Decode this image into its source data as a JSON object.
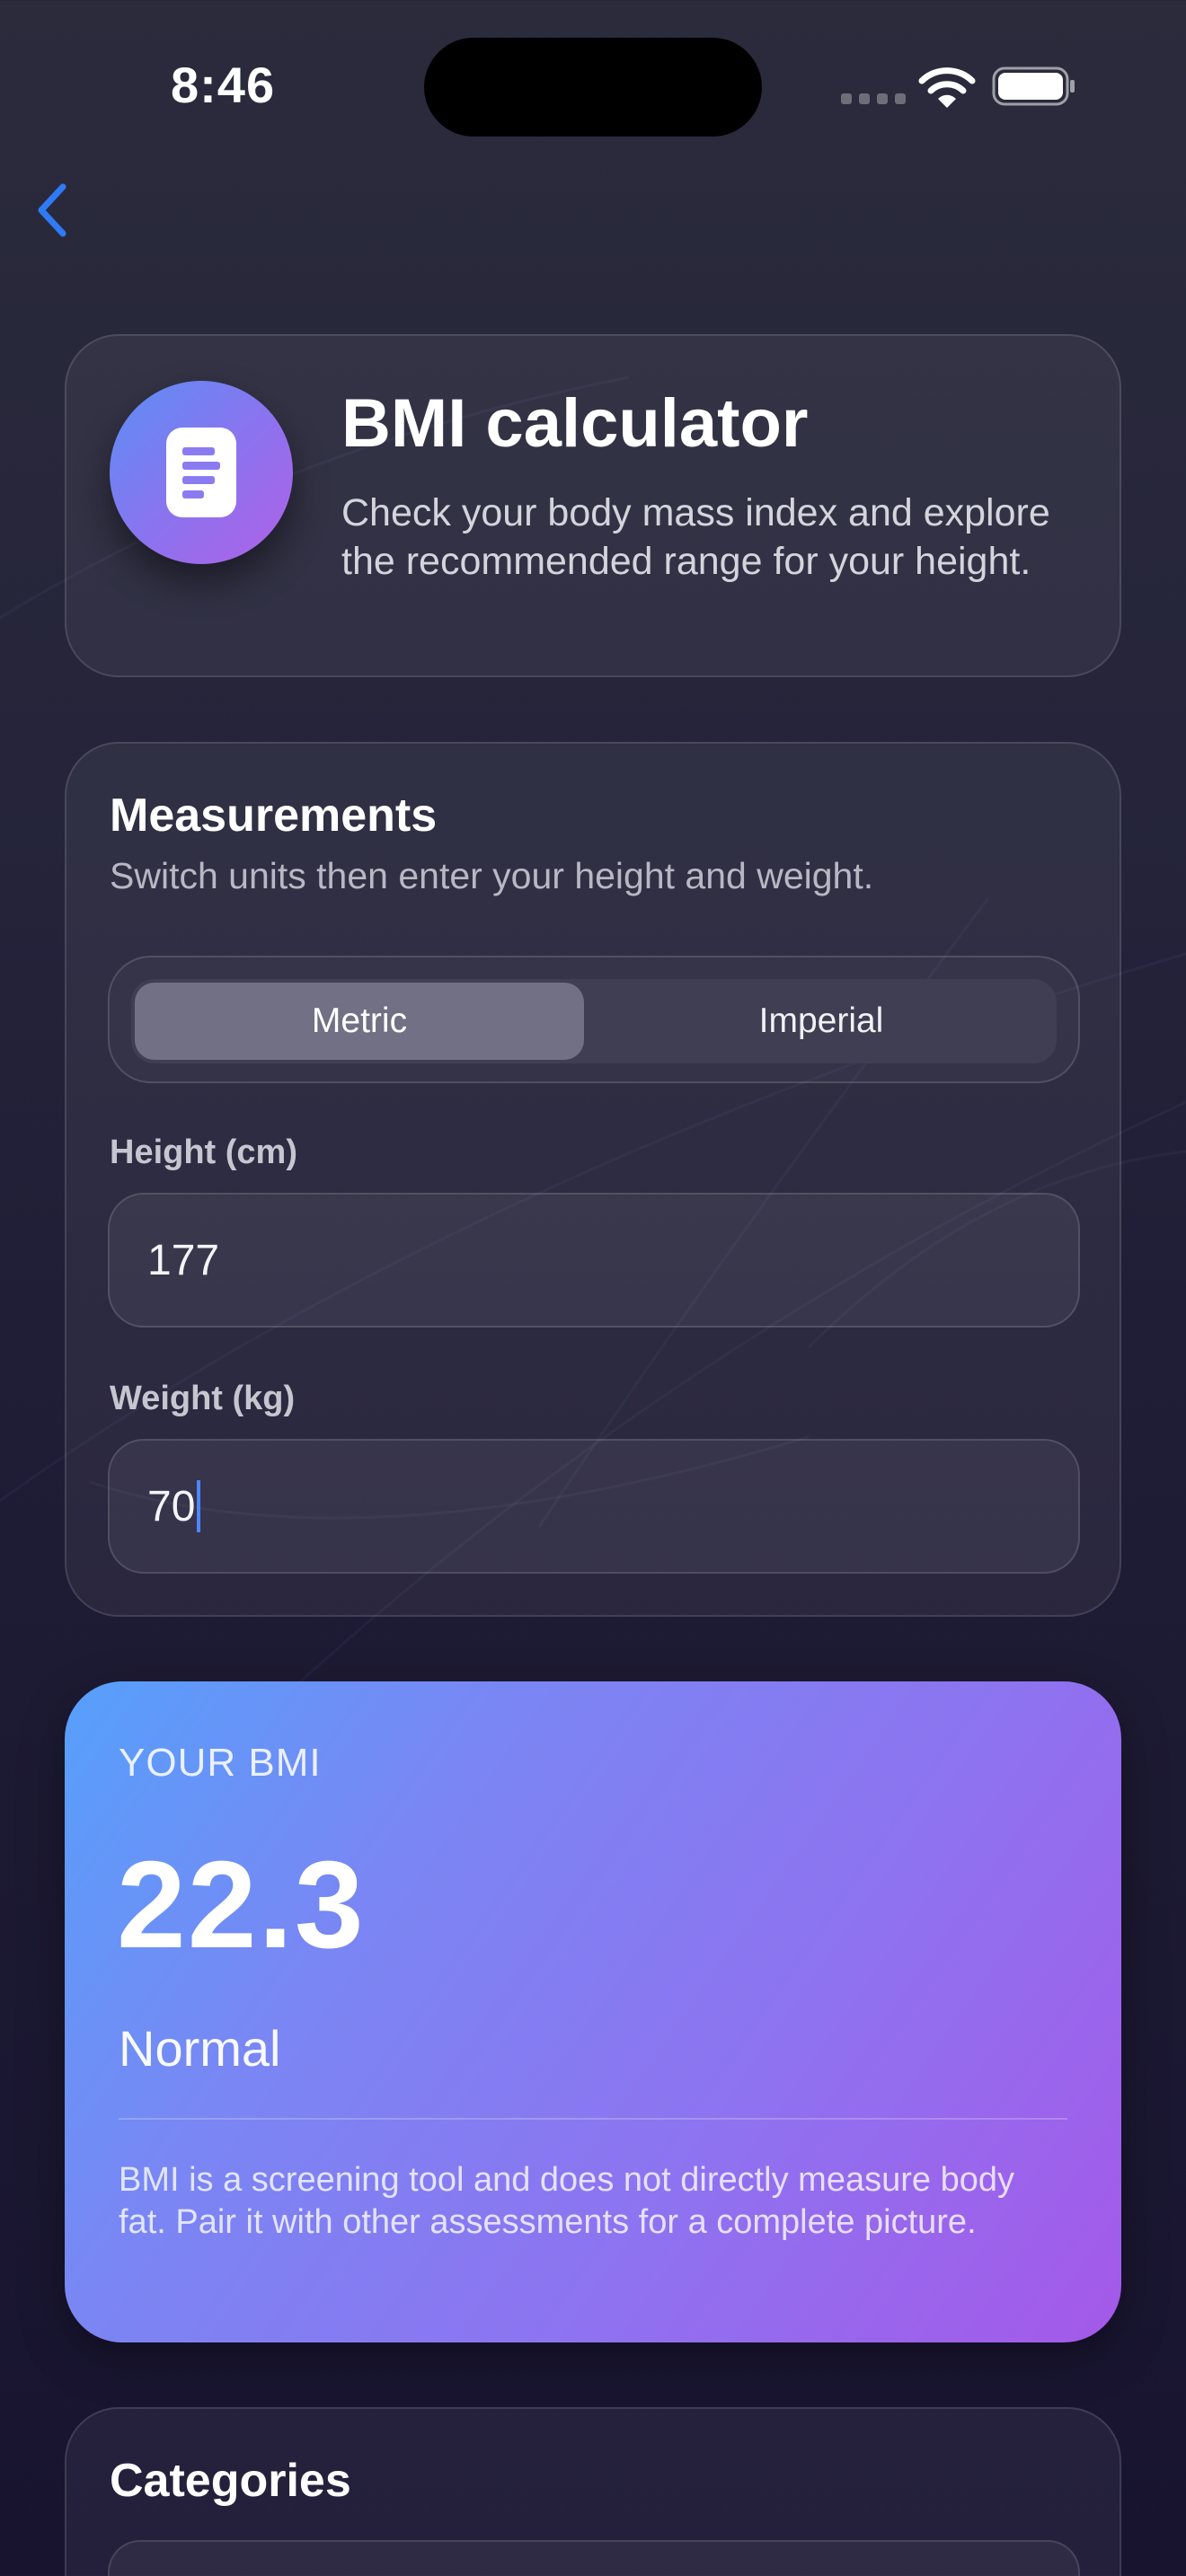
{
  "status_bar": {
    "time": "8:46"
  },
  "colors": {
    "accent": "#2f7bf5",
    "result_gradient_start": "#56a0fb",
    "result_gradient_end": "#a459e8"
  },
  "icons": {
    "back": "chevron-left-icon",
    "app": "document-icon",
    "wifi": "wifi-icon",
    "battery": "battery-icon"
  },
  "header": {
    "title": "BMI calculator",
    "description": "Check your body mass index and explore the recommended range for your height."
  },
  "measurements": {
    "title": "Measurements",
    "subtitle": "Switch units then enter your height and weight.",
    "unit_options": [
      "Metric",
      "Imperial"
    ],
    "selected_unit": "Metric",
    "height": {
      "label": "Height (cm)",
      "value": "177"
    },
    "weight": {
      "label": "Weight (kg)",
      "value": "70"
    }
  },
  "result": {
    "label": "YOUR BMI",
    "value": "22.3",
    "category": "Normal",
    "note": "BMI is a screening tool and does not directly measure body fat. Pair it with other assessments for a complete picture."
  },
  "categories": {
    "title": "Categories"
  }
}
